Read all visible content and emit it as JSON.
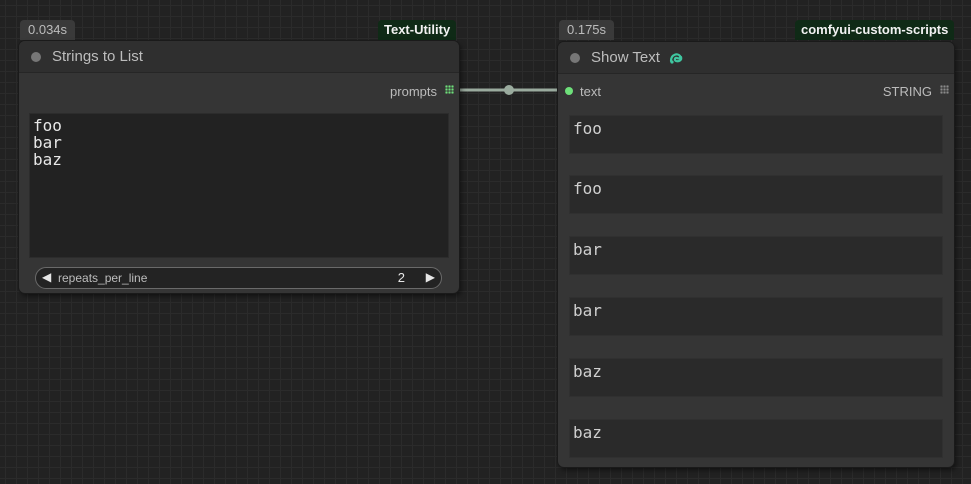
{
  "nodes": {
    "strings_to_list": {
      "time": "0.034s",
      "pack": "Text-Utility",
      "title": "Strings to List",
      "output_label": "prompts",
      "text": "foo\nbar\nbaz",
      "widget": {
        "name": "repeats_per_line",
        "value": "2"
      }
    },
    "show_text": {
      "time": "0.175s",
      "pack": "comfyui-custom-scripts",
      "title": "Show Text",
      "input_label": "text",
      "output_label": "STRING",
      "outputs": [
        "foo",
        "foo",
        "bar",
        "bar",
        "baz",
        "baz"
      ]
    }
  },
  "colors": {
    "canvas": "#222222",
    "node_body": "#353535",
    "pack_badge": "#0f2a16",
    "slot_connected": "#6ee07a",
    "icon_teal": "#3fc6a0",
    "link": "#9aab9e"
  },
  "icons": {
    "pysssss": "python-snake-icon",
    "slot_grid": "grid-dots-icon"
  }
}
